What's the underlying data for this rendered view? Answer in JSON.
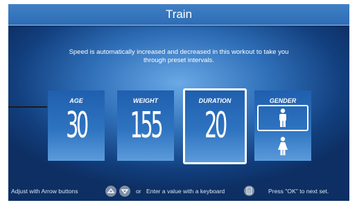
{
  "header": {
    "title": "Train"
  },
  "description": {
    "line1": "Speed is automatically increased and decreased in this workout to take you",
    "line2": "through preset intervals."
  },
  "tiles": [
    {
      "label": "AGE",
      "value": "30"
    },
    {
      "label": "WEIGHT",
      "value": "155"
    },
    {
      "label": "DURATION",
      "value": "20"
    },
    {
      "label": "GENDER",
      "options": [
        "male-icon",
        "female-icon"
      ],
      "selected": "male-icon"
    }
  ],
  "footer": {
    "adjust": "Adjust with Arrow buttons",
    "or": "or",
    "keyboard": "Enter a value with a keyboard",
    "press": "Press \"OK\" to next set."
  },
  "icons": {
    "up": "chevron-up-icon",
    "down": "chevron-down-icon",
    "keyboard": "keypad-icon"
  }
}
